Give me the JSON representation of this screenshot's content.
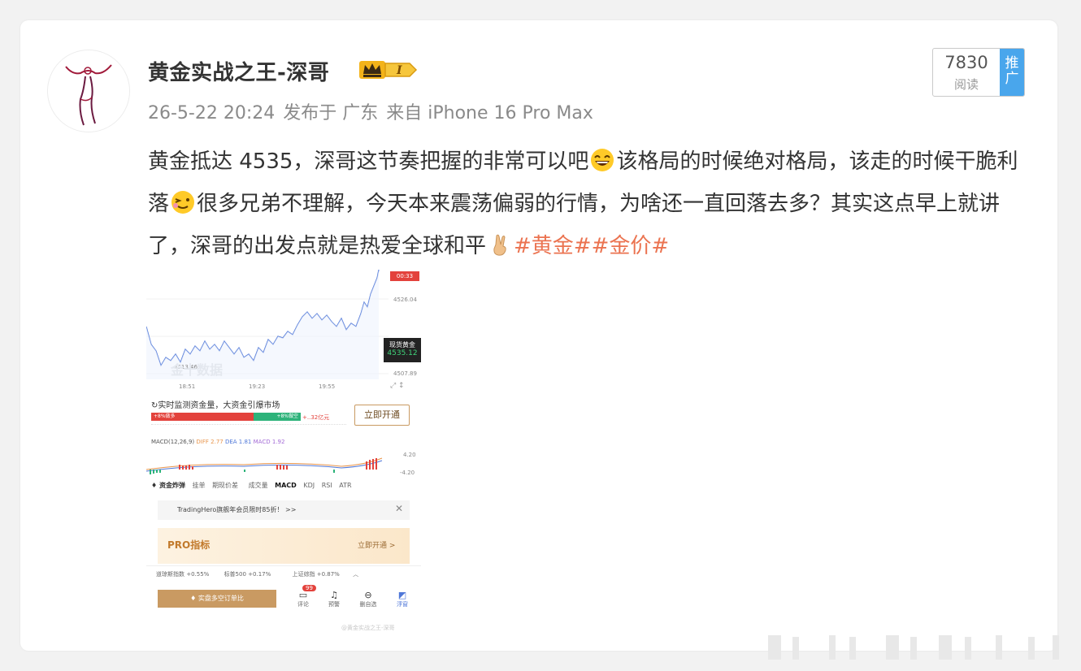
{
  "post": {
    "author": "黄金实战之王-深哥",
    "badge_level": "I",
    "date": "26-5-22 20:24",
    "published_in": "发布于 广东",
    "source": "来自 iPhone 16 Pro Max",
    "reads_count": "7830",
    "reads_label": "阅读",
    "promo_label": "推广",
    "content": {
      "part1": "黄金抵达 4535，深哥这节奏把握的非常可以吧",
      "part2": "该格局的时候绝对格局，该走的时候干脆利落",
      "part3": "很多兄弟不理解，今天本来震荡偏弱的行情，为啥还一直回落去多？其实这点早上就讲了，深哥的出发点就是热爱全球和平",
      "tag1": "#黄金#",
      "tag2": "#金价#"
    }
  },
  "screenshot": {
    "price_high": "4526.04",
    "price_low": "4507.89",
    "price_min_label": "4513.46",
    "time_badge": "00:33",
    "current_label": "现货黄金",
    "current_price": "4535.12",
    "times": [
      "18:51",
      "19:23",
      "19:55"
    ],
    "promo_title": "实时监测资金量，大资金引爆市场",
    "bar_left": "+8%做多",
    "bar_right": "+8%做空",
    "bar_amount": "+..32亿元",
    "open_btn": "立即开通",
    "macd_label": "MACD(12,26,9)",
    "diff": "DIFF 2.77",
    "dea": "DEA 1.81",
    "macd": "MACD 1.92",
    "macd_high": "4.20",
    "macd_low": "-4.20",
    "tabs": [
      "资金炸弹",
      "挂单",
      "期现价差",
      "成交量",
      "MACD",
      "KDJ",
      "RSI",
      "ATR"
    ],
    "banner": "TradingHero旗舰年会员限时85折！ >>",
    "pro_title": "PRO指标",
    "pro_link": "立即开通 >",
    "tickers": [
      "道琼斯指数 +0.55%",
      "标普500 +0.17%",
      "上证综指 +0.87%"
    ],
    "bottom_btn": "实盘多空订单比",
    "nav": [
      "评论",
      "预警",
      "删自选",
      "浮窗"
    ],
    "nav_badge": "99",
    "watermark": "@黄金实战之王-深哥",
    "chart_watermark": "金十数据"
  },
  "colors": {
    "tag": "#eb7350",
    "promo": "#49a6ec",
    "chart_line": "#4f77d8",
    "up": "#e3423c",
    "down": "#2db37a"
  }
}
